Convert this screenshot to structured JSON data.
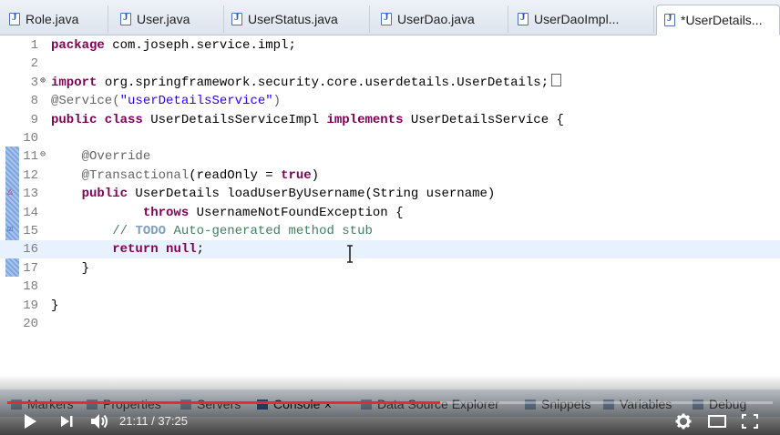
{
  "tabs": [
    {
      "label": "Role.java",
      "active": false
    },
    {
      "label": "User.java",
      "active": false
    },
    {
      "label": "UserStatus.java",
      "active": false
    },
    {
      "label": "UserDao.java",
      "active": false
    },
    {
      "label": "UserDaoImpl...",
      "active": false
    },
    {
      "label": "*UserDetails...",
      "active": true
    }
  ],
  "editor": {
    "lines": [
      {
        "n": "1",
        "tokens": [
          {
            "t": "kw",
            "v": "package"
          },
          {
            "t": "",
            "v": " com.joseph.service.impl;"
          }
        ]
      },
      {
        "n": "2",
        "tokens": []
      },
      {
        "n": "3",
        "tokens": [
          {
            "t": "kw",
            "v": "import"
          },
          {
            "t": "",
            "v": " org.springframework.security.core.userdetails.UserDetails;"
          }
        ]
      },
      {
        "n": "8",
        "tokens": [
          {
            "t": "ann",
            "v": "@Service("
          },
          {
            "t": "str",
            "v": "\"userDetailsService\""
          },
          {
            "t": "ann",
            "v": ")"
          }
        ]
      },
      {
        "n": "9",
        "tokens": [
          {
            "t": "kw",
            "v": "public class"
          },
          {
            "t": "",
            "v": " UserDetailsServiceImpl "
          },
          {
            "t": "kw",
            "v": "implements"
          },
          {
            "t": "",
            "v": " UserDetailsService {"
          }
        ]
      },
      {
        "n": "10",
        "tokens": []
      },
      {
        "n": "11",
        "tokens": [
          {
            "t": "",
            "v": "    "
          },
          {
            "t": "ann",
            "v": "@Override"
          }
        ]
      },
      {
        "n": "12",
        "tokens": [
          {
            "t": "",
            "v": "    "
          },
          {
            "t": "ann",
            "v": "@Transactional"
          },
          {
            "t": "",
            "v": "(readOnly = "
          },
          {
            "t": "kw",
            "v": "true"
          },
          {
            "t": "",
            "v": ")"
          }
        ]
      },
      {
        "n": "13",
        "tokens": [
          {
            "t": "",
            "v": "    "
          },
          {
            "t": "kw",
            "v": "public"
          },
          {
            "t": "",
            "v": " UserDetails loadUserByUsername(String username)"
          }
        ]
      },
      {
        "n": "14",
        "tokens": [
          {
            "t": "",
            "v": "            "
          },
          {
            "t": "kw",
            "v": "throws"
          },
          {
            "t": "",
            "v": " UsernameNotFoundException {"
          }
        ]
      },
      {
        "n": "15",
        "tokens": [
          {
            "t": "",
            "v": "        "
          },
          {
            "t": "cmt",
            "v": "// "
          },
          {
            "t": "todo",
            "v": "TODO"
          },
          {
            "t": "cmt",
            "v": " Auto-generated method stub"
          }
        ]
      },
      {
        "n": "16",
        "tokens": [
          {
            "t": "",
            "v": "        "
          },
          {
            "t": "kw",
            "v": "return"
          },
          {
            "t": "",
            "v": " "
          },
          {
            "t": "kw",
            "v": "null"
          },
          {
            "t": "",
            "v": ";"
          }
        ]
      },
      {
        "n": "17",
        "tokens": [
          {
            "t": "",
            "v": "    }"
          }
        ]
      },
      {
        "n": "18",
        "tokens": []
      },
      {
        "n": "19",
        "tokens": [
          {
            "t": "",
            "v": "}"
          }
        ]
      },
      {
        "n": "20",
        "tokens": []
      }
    ],
    "current_line": "16"
  },
  "bottom_panel": {
    "tabs": [
      {
        "label": "Markers",
        "icon": "markers-icon"
      },
      {
        "label": "Properties",
        "icon": "properties-icon"
      },
      {
        "label": "Servers",
        "icon": "servers-icon"
      },
      {
        "label": "Console",
        "icon": "console-icon",
        "selected": true
      },
      {
        "label": "Data Source Explorer",
        "icon": "database-icon"
      },
      {
        "label": "Snippets",
        "icon": "snippets-icon"
      },
      {
        "label": "Variables",
        "icon": "variables-icon"
      },
      {
        "label": "Debug",
        "icon": "debug-icon"
      }
    ]
  },
  "player": {
    "current_time": "21:11",
    "duration": "37:25",
    "time_display": "21:11 / 37:25",
    "progress": 0.566,
    "accent": "#e52d27"
  }
}
